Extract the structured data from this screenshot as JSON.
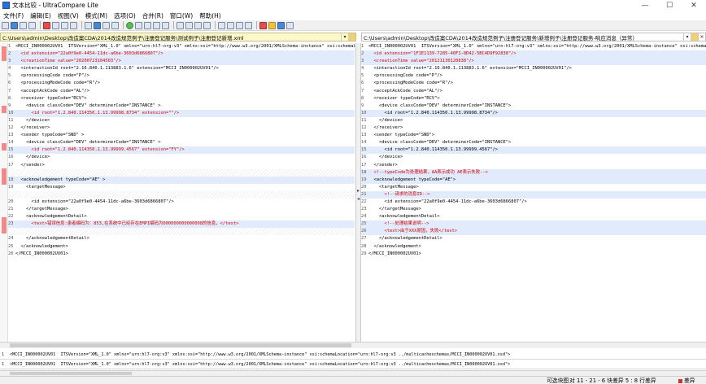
{
  "window": {
    "title": "文本比较 - UltraCompare Lite",
    "controls": [
      "—",
      "☐",
      "✕"
    ]
  },
  "menu": [
    "文件(F)",
    "编辑(E)",
    "视图(V)",
    "模式(M)",
    "选项(O)",
    "合并(R)",
    "窗口(W)",
    "帮助(H)"
  ],
  "paths": {
    "left": "C:\\Users\\admin\\Desktop\\改造案CDA\\2014改造规范例子\\注册登记服务\\测试例子\\注册登记新增.xml",
    "right": "C:\\Users\\admin\\Desktop\\改造案CDA\\2014改造规范例子\\注册登记服务\\新增例子\\注册登记服务-响应消息（异常）"
  },
  "left_lines": [
    {
      "n": "1",
      "t": "<MCCI_IN000002UV01  ITSVersion=\"XML_1.0\" xmlns=\"urn:hl7-org:v3\" xmlns:xsi=\"http://www.w3.org/2001/XMLSchema-instance\" xsi:schemaLoc",
      "d": false
    },
    {
      "n": "2",
      "t": "  <id extension=\"22a0f9e0-4454-11dc-a6be-3603d6866807\"/>",
      "d": true,
      "r": true
    },
    {
      "n": "3",
      "t": "  <creationTime value=\"20200723104503\"/>",
      "d": true,
      "r": true
    },
    {
      "n": "4",
      "t": "  <interactionId root=\"2.16.840.1.113883.1.6\" extension=\"MCCI_IN000002UV01\"/>",
      "d": false
    },
    {
      "n": "5",
      "t": "  <processingCode code=\"P\"/>",
      "d": false
    },
    {
      "n": "6",
      "t": "  <processingModeCode code=\"R\"/>",
      "d": false
    },
    {
      "n": "7",
      "t": "  <acceptAckCode code=\"AL\"/>",
      "d": false
    },
    {
      "n": "8",
      "t": "  <receiver typeCode=\"RCV\">",
      "d": false
    },
    {
      "n": "9",
      "t": "    <device classCode=\"DEV\" determinerCode=\"INSTANCE\" >",
      "d": false
    },
    {
      "n": "10",
      "t": "      <id root=\"1.2.840.114350.1.13.99998.8734\" extension=\"\"/>",
      "d": true,
      "r": true
    },
    {
      "n": "11",
      "t": "    </device>",
      "d": false
    },
    {
      "n": "12",
      "t": "  </receiver>",
      "d": false
    },
    {
      "n": "13",
      "t": "  <sender typeCode=\"SND\" >",
      "d": false
    },
    {
      "n": "14",
      "t": "    <device classCode=\"DEV\" determinerCode=\"INSTANCE\" >",
      "d": false
    },
    {
      "n": "15",
      "t": "      <id root=\"1.2.840.114350.1.13.99999.4567\" extension=\"FY\"/>",
      "d": true,
      "r": true
    },
    {
      "n": "16",
      "t": "    </device>",
      "d": false
    },
    {
      "n": "17",
      "t": "  </sender>",
      "d": false
    },
    {
      "n": "",
      "t": "",
      "d": false,
      "b": true
    },
    {
      "n": "18",
      "t": "  <acknowledgement typeCode=\"AE\" >",
      "d": true
    },
    {
      "n": "19",
      "t": "    <targetMessage>",
      "d": false
    },
    {
      "n": "",
      "t": "",
      "d": false,
      "b": true
    },
    {
      "n": "20",
      "t": "      <id extension=\"22a0f9e0-4454-11dc-a6be-3603d6866807\"/>",
      "d": false
    },
    {
      "n": "21",
      "t": "    </targetMessage>",
      "d": false
    },
    {
      "n": "22",
      "t": "    <acknowledgementDetail>",
      "d": false
    },
    {
      "n": "23",
      "t": "      <text>错误信息:患者编码为：853,在系统中已经存在EMPI编码为000000000000008的信息，</text>",
      "d": true,
      "r": true
    },
    {
      "n": "",
      "t": "",
      "d": false,
      "b": true
    },
    {
      "n": "24",
      "t": "    </acknowledgementDetail>",
      "d": false
    },
    {
      "n": "25",
      "t": "  </acknowledgement>",
      "d": false
    },
    {
      "n": "26",
      "t": "</MCCI_IN000002UV01>",
      "d": false
    }
  ],
  "right_lines": [
    {
      "n": "1",
      "t": "<MCCI_IN000002UV01  ITSVersion=\"XML_1.0\" xmlns=\"urn:hl7-org:v3\" xmlns:xsi=\"http://www.w3.org/2001/XMLSchema-instance\" xsi:schemaLoc",
      "d": false
    },
    {
      "n": "2",
      "t": "  <id extension=\"1F1E1139-7285-40F1-8D42-5BC4D9F92838\"/>",
      "d": true,
      "r": true
    },
    {
      "n": "3",
      "t": "  <creationTime value=\"20121130120838\"/>",
      "d": true,
      "r": true
    },
    {
      "n": "4",
      "t": "  <interactionId root=\"2.16.840.1.113883.1.6\" extension=\"MCCI_IN000002UV01\"/>",
      "d": false
    },
    {
      "n": "5",
      "t": "  <processingCode code=\"P\"/>",
      "d": false
    },
    {
      "n": "6",
      "t": "  <processingModeCode code=\"R\"/>",
      "d": false
    },
    {
      "n": "7",
      "t": "  <acceptAckCode code=\"AL\"/>",
      "d": false
    },
    {
      "n": "8",
      "t": "  <receiver typeCode=\"RCV\">",
      "d": false
    },
    {
      "n": "9",
      "t": "    <device classCode=\"DEV\" determinerCode=\"INSTANCE\">",
      "d": false
    },
    {
      "n": "10",
      "t": "      <id root=\"1.2.840.114350.1.13.99998.8734\"/>",
      "d": true
    },
    {
      "n": "11",
      "t": "    </device>",
      "d": false
    },
    {
      "n": "12",
      "t": "  </receiver>",
      "d": false
    },
    {
      "n": "13",
      "t": "  <sender typeCode=\"SND\">",
      "d": false
    },
    {
      "n": "14",
      "t": "    <device classCode=\"DEV\" determinerCode=\"INSTANCE\">",
      "d": false
    },
    {
      "n": "15",
      "t": "      <id root=\"1.2.840.114350.1.13.99999.4567\"/>",
      "d": true
    },
    {
      "n": "16",
      "t": "    </device>",
      "d": false
    },
    {
      "n": "17",
      "t": "  </sender>",
      "d": false
    },
    {
      "n": "18",
      "t": "  <!--typeCode为处理结果，AA表示成功 AE表示失败-->",
      "d": true,
      "r": true
    },
    {
      "n": "19",
      "t": "  <acknowledgement typeCode=\"AE\">",
      "d": true
    },
    {
      "n": "20",
      "t": "    <targetMessage>",
      "d": false
    },
    {
      "n": "21",
      "t": "      <!--请求的消息ID-->",
      "d": true,
      "r": true
    },
    {
      "n": "22",
      "t": "      <id extension=\"22a0f9e0-4454-11dc-a6be-3603d6866807\"/>",
      "d": false
    },
    {
      "n": "23",
      "t": "    </targetMessage>",
      "d": false
    },
    {
      "n": "24",
      "t": "    <acknowledgementDetail>",
      "d": false
    },
    {
      "n": "25",
      "t": "      <!--处理结果说明-->",
      "d": true,
      "r": true
    },
    {
      "n": "26",
      "t": "      <text>由于XXX原因，失败</text>",
      "d": true,
      "r": true
    },
    {
      "n": "27",
      "t": "    </acknowledgementDetail>",
      "d": false
    },
    {
      "n": "28",
      "t": "  </acknowledgement>",
      "d": false
    },
    {
      "n": "29",
      "t": "</MCCI_IN000002UV01>",
      "d": false
    }
  ],
  "bottom": {
    "line1": "<MCCI_IN000002UV01  ITSVersion=\"XML_1.0\" xmlns=\"urn:hl7-org:v3\" xmlns:xsi=\"http://www.w3.org/2001/XMLSchema-instance\" xsi:schemaLocation=\"urn:hl7-org:v3 ../multicacheschemas/MCCI_IN000002UV01.xsd\">",
    "line2": "<MCCI_IN000002UV01  ITSVersion=\"XML_1.0\" xmlns=\"urn:hl7-org:v3\" xmlns:xsi=\"http://www.w3.org/2001/XMLSchema-instance\" xsi:schemaLocation=\"urn:hl7-org:v3 ../multicacheschemas/MCCI_IN000002UV01.xsd\">",
    "n1": "1",
    "n2": "1"
  },
  "status": {
    "mode": "可选块图",
    "counts": "对 11 - 21 - 6 块差异  5 : 8 行差异",
    "state": "差异"
  }
}
